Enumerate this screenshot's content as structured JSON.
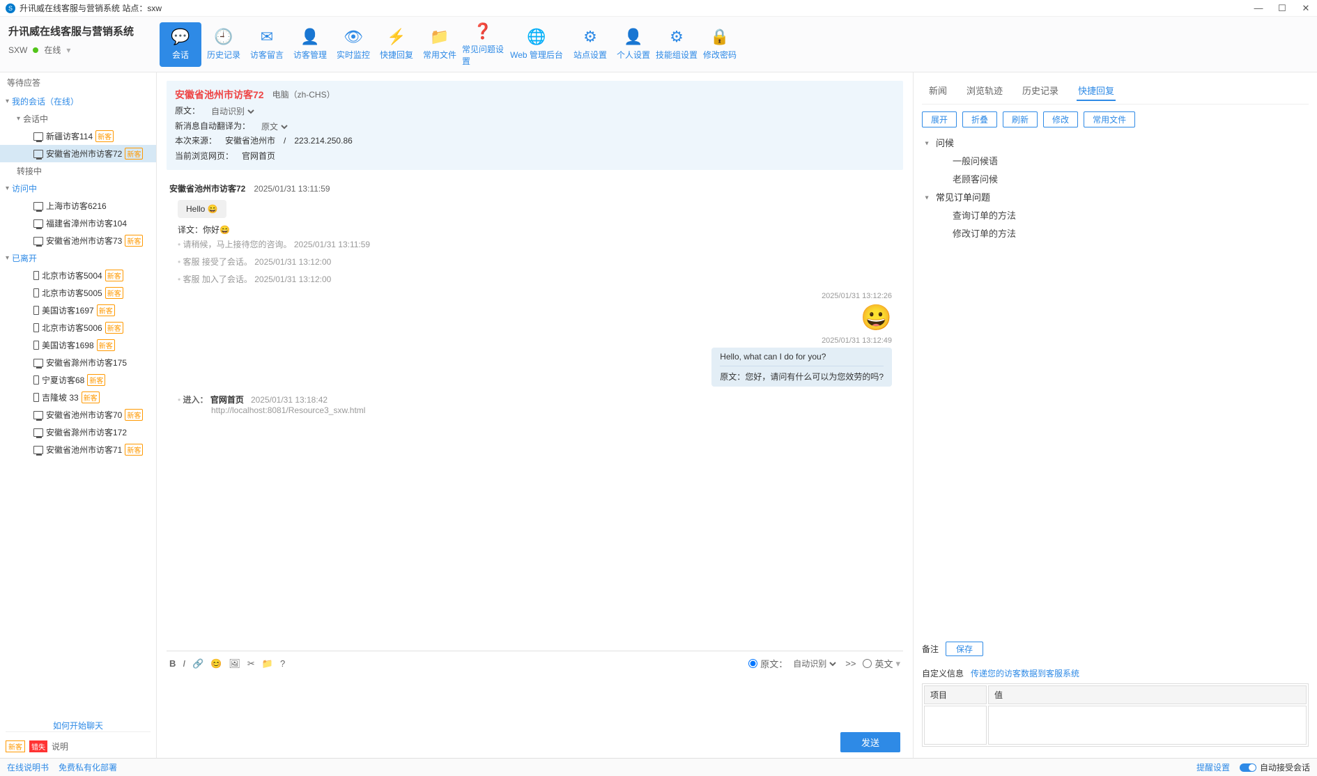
{
  "titlebar": {
    "text": "升讯威在线客服与营销系统  站点：sxw"
  },
  "app": {
    "title": "升讯威在线客服与营销系统",
    "site": "SXW",
    "status": "在线"
  },
  "toolbar": [
    {
      "label": "会话",
      "active": true
    },
    {
      "label": "历史记录"
    },
    {
      "label": "访客留言"
    },
    {
      "label": "访客管理"
    },
    {
      "label": "实时监控"
    },
    {
      "label": "快捷回复"
    },
    {
      "label": "常用文件"
    },
    {
      "label": "常见问题设置"
    },
    {
      "label": "Web 管理后台",
      "wide": true
    },
    {
      "label": "站点设置"
    },
    {
      "label": "个人设置"
    },
    {
      "label": "技能组设置"
    },
    {
      "label": "修改密码"
    }
  ],
  "side": {
    "waiting": "等待应答",
    "my_sessions": "我的会话（在线）",
    "in_session": "会话中",
    "transfer": "转接中",
    "visiting": "访问中",
    "left": "已离开",
    "sessions_active": [
      {
        "name": "新疆访客114",
        "new": true,
        "dev": "pc"
      },
      {
        "name": "安徽省池州市访客72",
        "new": true,
        "dev": "pc",
        "active": true
      }
    ],
    "visiting_list": [
      {
        "name": "上海市访客6216",
        "dev": "pc"
      },
      {
        "name": "福建省漳州市访客104",
        "dev": "pc"
      },
      {
        "name": "安徽省池州市访客73",
        "new": true,
        "dev": "pc"
      }
    ],
    "left_list": [
      {
        "name": "北京市访客5004",
        "new": true,
        "dev": "mobile"
      },
      {
        "name": "北京市访客5005",
        "new": true,
        "dev": "mobile"
      },
      {
        "name": "美国访客1697",
        "new": true,
        "dev": "mobile"
      },
      {
        "name": "北京市访客5006",
        "new": true,
        "dev": "mobile"
      },
      {
        "name": "美国访客1698",
        "new": true,
        "dev": "mobile"
      },
      {
        "name": "安徽省滁州市访客175",
        "dev": "pc"
      },
      {
        "name": "宁夏访客68",
        "new": true,
        "dev": "mobile"
      },
      {
        "name": "吉隆坡 33",
        "new": true,
        "dev": "mobile"
      },
      {
        "name": "安徽省池州市访客70",
        "new": true,
        "dev": "pc"
      },
      {
        "name": "安徽省滁州市访客172",
        "dev": "pc"
      },
      {
        "name": "安徽省池州市访客71",
        "new": true,
        "dev": "pc"
      }
    ],
    "how_start": "如何开始聊天",
    "tag_new": "新客",
    "tag_miss": "错失",
    "desc": "说明"
  },
  "info": {
    "visitor": "安徽省池州市访客72",
    "device": "电脑（zh-CHS）",
    "orig_label": "原文：",
    "orig_sel": "自动识别",
    "trans_label": "新消息自动翻译为：",
    "trans_sel": "原文",
    "source_label": "本次来源：",
    "source_loc": "安徽省池州市",
    "source_ip": "223.214.250.86",
    "page_label": "当前浏览网页：",
    "page": "官网首页"
  },
  "chat": {
    "h1_name": "安徽省池州市访客72",
    "h1_time": "2025/01/31 13:11:59",
    "m1": "Hello 😄",
    "m1t_label": "译文：",
    "m1t": "你好😄",
    "s1": "请稍候，马上接待您的咨询。 2025/01/31 13:11:59",
    "s2": "客服 接受了会话。 2025/01/31 13:12:00",
    "s3": "客服 加入了会话。 2025/01/31 13:12:00",
    "o1_time": "2025/01/31 13:12:26",
    "o2_time": "2025/01/31 13:12:49",
    "o2_text": "Hello, what can I do for you?",
    "o2_orig_label": "原文：",
    "o2_orig": "您好，请问有什么可以为您效劳的吗?",
    "enter_label": "进入：",
    "enter_page": "官网首页",
    "enter_time": "2025/01/31 13:18:42",
    "enter_url": "http://localhost:8081/Resource3_sxw.html"
  },
  "input": {
    "orig": "原文：",
    "autod": "自动识别",
    "arrow": ">>",
    "eng": "英文",
    "send": "发送"
  },
  "right": {
    "tabs": [
      "新闻",
      "浏览轨迹",
      "历史记录",
      "快捷回复"
    ],
    "btns": [
      "展开",
      "折叠",
      "刷新",
      "修改",
      "常用文件"
    ],
    "cat1": "问候",
    "c1i1": "一般问候语",
    "c1i2": "老顾客问候",
    "cat2": "常见订单问题",
    "c2i1": "查询订单的方法",
    "c2i2": "修改订单的方法",
    "note": "备注",
    "save": "保存",
    "custom": "自定义信息",
    "custom_link": "传递您的访客数据到客服系统",
    "col1": "项目",
    "col2": "值"
  },
  "footer": {
    "l1": "在线说明书",
    "l2": "免费私有化部署",
    "r1": "提醒设置",
    "r2": "自动接受会话"
  }
}
